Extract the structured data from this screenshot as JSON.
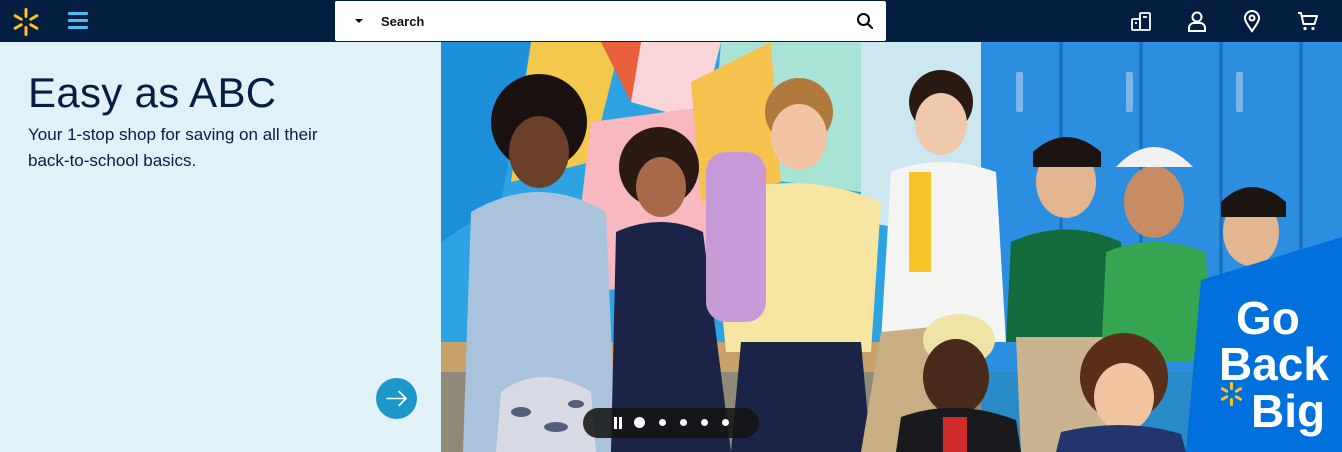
{
  "header": {
    "logo_icon": "walmart-spark-icon",
    "menu_icon": "hamburger-menu-icon",
    "search": {
      "placeholder": "Search",
      "department_icon": "caret-down-icon",
      "submit_icon": "search-icon"
    },
    "icons": [
      "reorder-icon",
      "account-icon",
      "store-location-icon",
      "cart-icon"
    ]
  },
  "promo": {
    "title": "Easy as ABC",
    "subtitle": "Your 1-stop shop for saving on all their back-to-school basics.",
    "next_icon": "arrow-right-icon"
  },
  "hero": {
    "badge_lines": [
      "Go",
      "Back",
      "Big"
    ]
  },
  "carousel": {
    "slide_count": 5,
    "active_slide": 1,
    "pause_icon": "pause-icon"
  },
  "colors": {
    "header_bg": "#041e42",
    "accent_blue": "#4dbdf5",
    "spark_yellow": "#ffc220",
    "promo_bg": "#e0f1f8",
    "promo_text": "#041e42",
    "next_button": "#1b98c9",
    "badge_blue": "#0071dc"
  }
}
